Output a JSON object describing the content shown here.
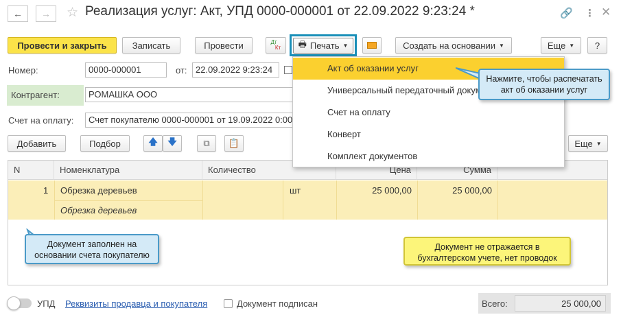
{
  "header": {
    "title": "Реализация услуг: Акт, УПД 0000-000001 от 22.09.2022 9:23:24 *",
    "back_icon": "arrow-left-icon",
    "forward_icon": "arrow-right-icon",
    "favorite_icon": "star-icon",
    "link_icon": "link-icon",
    "more_icon": "vertical-dots-icon",
    "close_icon": "close-icon"
  },
  "toolbar": {
    "post_close": "Провести и закрыть",
    "save": "Записать",
    "post": "Провести",
    "dt_kt_top": "Дт",
    "dt_kt_bottom": "Кт",
    "print": "Печать",
    "create_based": "Создать на основании",
    "more": "Еще",
    "help": "?"
  },
  "form": {
    "number_label": "Номер:",
    "number_value": "0000-000001",
    "date_label": "от:",
    "date_value": "22.09.2022  9:23:24",
    "counterparty_label": "Контрагент:",
    "counterparty_value": "РОМАШКА ООО",
    "invoice_label": "Счет на оплату:",
    "invoice_value": "Счет покупателю 0000-000001 от 19.09.2022 0:00:00"
  },
  "table_toolbar": {
    "add": "Добавить",
    "pick": "Подбор",
    "more": "Еще"
  },
  "table": {
    "columns": [
      "N",
      "Номенклатура",
      "Количество",
      "Цена",
      "Сумма"
    ],
    "rows": [
      {
        "n": "1",
        "item": "Обрезка деревьев",
        "item_desc": "Обрезка деревьев",
        "qty": "",
        "unit": "шт",
        "price": "25 000,00",
        "sum": "25 000,00"
      }
    ]
  },
  "print_menu": {
    "items": [
      "Акт об оказании услуг",
      "Универсальный передаточный документ",
      "Счет на оплату",
      "Конверт",
      "Комплект документов"
    ],
    "selected_index": 0
  },
  "callouts": {
    "print_hint": "Нажмите, чтобы распечатать акт об оказании услуг",
    "filled_hint": "Документ заполнен на основании счета покупателю",
    "accounting_hint": "Документ не отражается в бухгалтерском учете, нет проводок"
  },
  "footer": {
    "upd_label": "УПД",
    "requisites_link": "Реквизиты продавца и покупателя",
    "signed_label": "Документ подписан",
    "total_label": "Всего:",
    "total_value": "25 000,00"
  },
  "colors": {
    "primary_button": "#fbe349",
    "selected_row": "#fbeeb8",
    "menu_highlight": "#fbd02f",
    "callout_blue_border": "#4a9ac8",
    "callout_yellow_bg": "#fcf57a",
    "print_highlight_border": "#1a8fb8"
  }
}
